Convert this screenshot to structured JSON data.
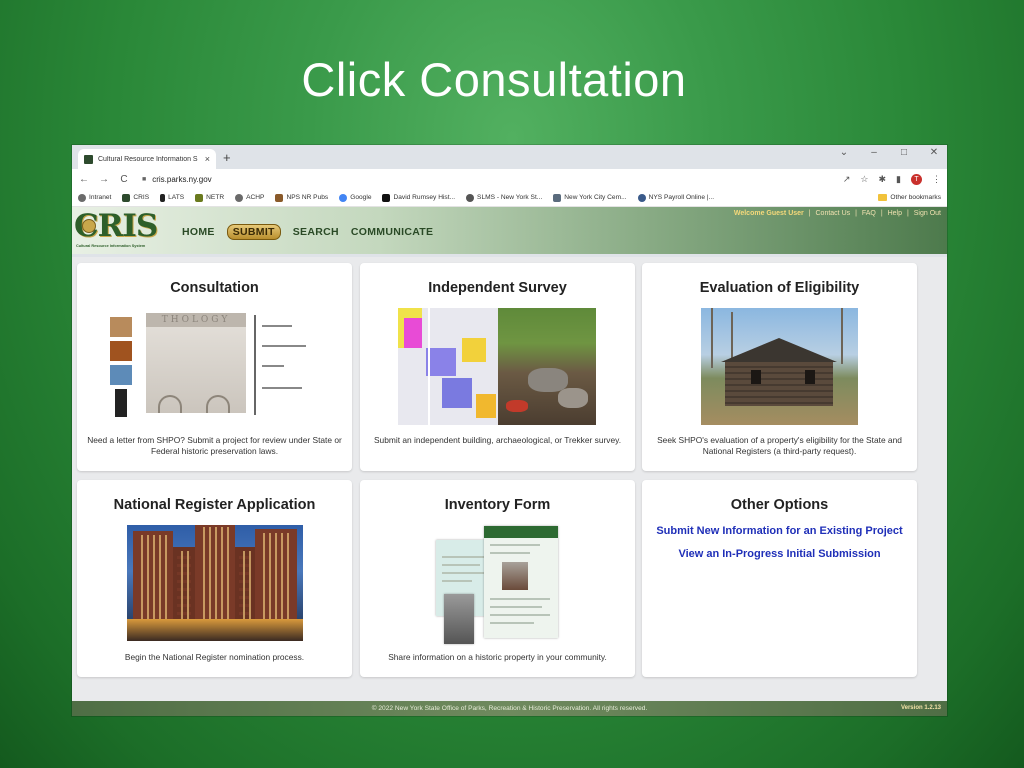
{
  "slide": {
    "title": "Click Consultation"
  },
  "browser": {
    "tab_title": "Cultural Resource Information S",
    "tab_close": "×",
    "new_tab": "+",
    "url": "cris.parks.ny.gov",
    "window_controls": {
      "chevron": "⌄",
      "minimize": "–",
      "maximize": "□",
      "close": "✕"
    },
    "nav": {
      "back": "←",
      "forward": "→",
      "reload": "C"
    },
    "profile_initial": "T",
    "bookmarks": [
      "Intranet",
      "CRIS",
      "LATS",
      "NETR",
      "ACHP",
      "NPS NR Pubs",
      "Google",
      "David Rumsey Hist...",
      "SLMS - New York St...",
      "New York City Cem...",
      "NYS Payroll Online |..."
    ],
    "other_bookmarks": "Other bookmarks"
  },
  "cris": {
    "logo_text": "CRIS",
    "logo_sub": "Cultural Resource Information System",
    "nav": {
      "home": "HOME",
      "submit": "SUBMIT",
      "search": "SEARCH",
      "communicate": "COMMUNICATE"
    },
    "user_links": {
      "welcome": "Welcome Guest User",
      "contact": "Contact Us",
      "faq": "FAQ",
      "help": "Help",
      "signout": "Sign Out",
      "sep": "|"
    }
  },
  "cards": {
    "consultation": {
      "title": "Consultation",
      "frieze": "THOLOGY",
      "desc": "Need a letter from SHPO? Submit a project for review under State or Federal historic preservation laws."
    },
    "survey": {
      "title": "Independent Survey",
      "desc": "Submit an independent building, archaeological, or Trekker survey."
    },
    "eligibility": {
      "title": "Evaluation of Eligibility",
      "desc": "Seek SHPO's evaluation of a property's eligibility for the State and National Registers (a third-party request)."
    },
    "national_register": {
      "title": "National Register Application",
      "desc": "Begin the National Register nomination process."
    },
    "inventory": {
      "title": "Inventory Form",
      "desc": "Share information on a historic property in your community."
    },
    "other": {
      "title": "Other Options",
      "link1": "Submit New Information for an Existing Project",
      "link2": "View an In-Progress Initial Submission"
    }
  },
  "footer": {
    "text": "© 2022 New York State Office of Parks, Recreation & Historic Preservation. All rights reserved.",
    "version": "Version 1.2.13"
  },
  "colors": {
    "slide_bg": "#2a8838",
    "link": "#1f2fb8",
    "cris_green": "#2f5a2a",
    "submit_gold": "#c9a74b"
  }
}
